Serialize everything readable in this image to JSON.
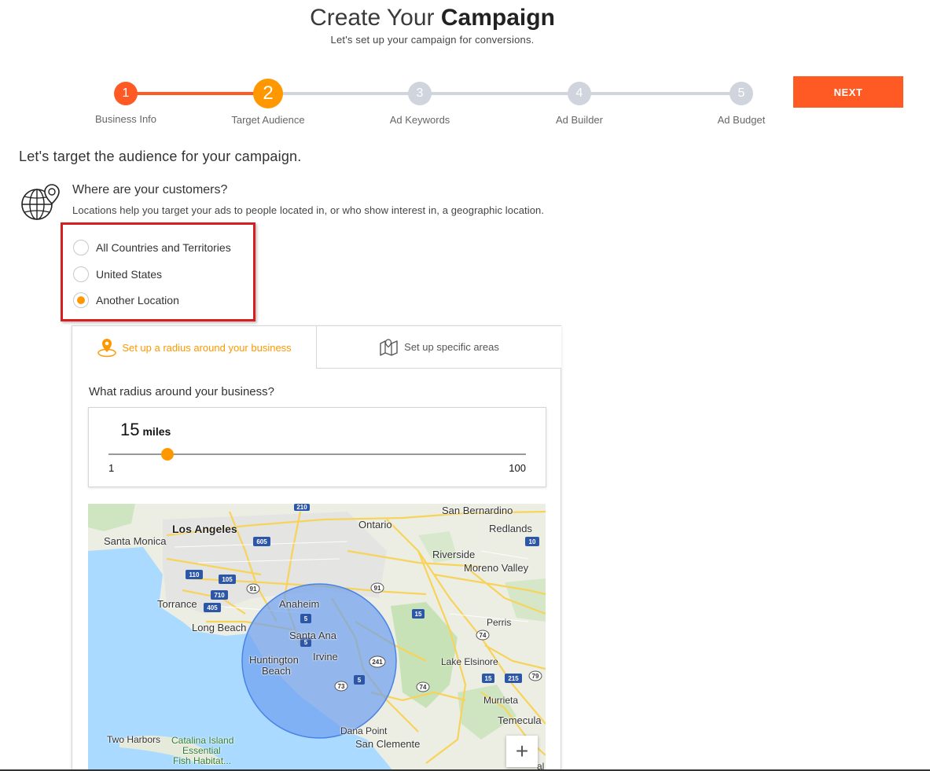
{
  "header": {
    "title_light": "Create Your",
    "title_bold": "Campaign",
    "subtitle": "Let's set up your campaign for conversions."
  },
  "stepper": {
    "steps": [
      {
        "number": "1",
        "label": "Business Info",
        "state": "done"
      },
      {
        "number": "2",
        "label": "Target Audience",
        "state": "current"
      },
      {
        "number": "3",
        "label": "Ad Keywords",
        "state": "pending"
      },
      {
        "number": "4",
        "label": "Ad Builder",
        "state": "pending"
      },
      {
        "number": "5",
        "label": "Ad Budget",
        "state": "pending"
      }
    ]
  },
  "next_button": {
    "label": "NEXT"
  },
  "section_heading": "Let's target the audience for your campaign.",
  "location_question": {
    "title": "Where are your customers?",
    "description": "Locations help you target your ads to people located in, or who show interest in, a geographic location.",
    "icon": "globe-pin-icon"
  },
  "location_options": [
    {
      "label": "All Countries and Territories",
      "selected": false
    },
    {
      "label": "United States",
      "selected": false
    },
    {
      "label": "Another Location",
      "selected": true
    }
  ],
  "tabs": {
    "radius": {
      "label": "Set up a radius around your business",
      "icon": "location-pin-icon",
      "active": true
    },
    "areas": {
      "label": "Set up specific areas",
      "icon": "map-icon",
      "active": false
    }
  },
  "radius": {
    "question": "What radius around your business?",
    "value": "15",
    "value_number": 15,
    "unit": "miles",
    "min": "1",
    "max": "100"
  },
  "map": {
    "labels": {
      "los_angeles": "Los Angeles",
      "santa_monica": "Santa Monica",
      "ontario": "Ontario",
      "san_bernardino": "San Bernardino",
      "redlands": "Redlands",
      "riverside": "Riverside",
      "moreno_valley": "Moreno Valley",
      "torrance": "Torrance",
      "long_beach": "Long Beach",
      "anaheim": "Anaheim",
      "santa_ana": "Santa Ana",
      "irvine": "Irvine",
      "huntington_beach_1": "Huntington",
      "huntington_beach_2": "Beach",
      "perris": "Perris",
      "lake_elsinore": "Lake Elsinore",
      "murrieta": "Murrieta",
      "temecula": "Temecula",
      "dana_point": "Dana Point",
      "san_clemente": "San Clemente",
      "two_harbors": "Two Harbors",
      "catalina_1": "Catalina Island",
      "catalina_2": "Essential",
      "catalina_3": "Fish Habitat..."
    },
    "shields": [
      "210",
      "605",
      "10",
      "110",
      "105",
      "710",
      "405",
      "91",
      "91",
      "15",
      "5",
      "5",
      "241",
      "73",
      "74",
      "74",
      "15",
      "215",
      "79",
      "5"
    ],
    "zoom_in": "+",
    "cutoff_label": "al"
  },
  "colors": {
    "accent_orange": "#ff5a24",
    "selection_orange": "#ff9800",
    "highlight_red": "#d61f1f",
    "radius_circle": "#6e9ff0"
  }
}
